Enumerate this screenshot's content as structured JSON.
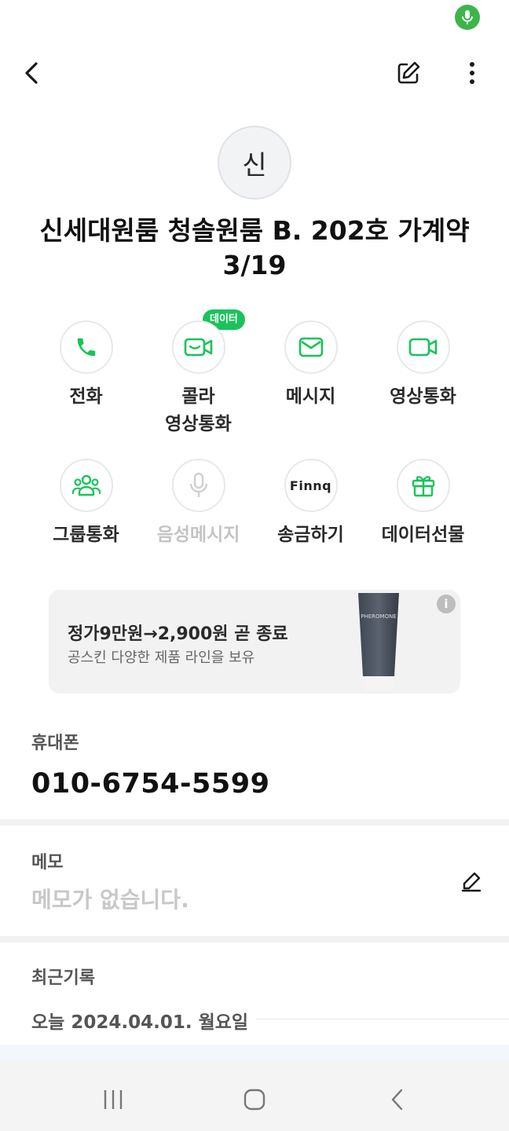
{
  "header": {
    "back_icon": "chevron-left-icon",
    "edit_icon": "edit-icon",
    "more_icon": "more-vertical-icon"
  },
  "contact": {
    "avatar_initial": "신",
    "name_line1": "신세대원룸 청솔원룸 B. 202호  가계약",
    "name_line2": "3/19"
  },
  "actions": [
    {
      "label": "전화",
      "icon": "phone-icon",
      "enabled": true
    },
    {
      "label": "콜라\n영상통화",
      "icon": "video-message-icon",
      "enabled": true,
      "badge": "데이터"
    },
    {
      "label": "메시지",
      "icon": "mail-icon",
      "enabled": true
    },
    {
      "label": "영상통화",
      "icon": "video-camera-icon",
      "enabled": true
    },
    {
      "label": "그룹통화",
      "icon": "group-icon",
      "enabled": true
    },
    {
      "label": "음성메시지",
      "icon": "microphone-icon",
      "enabled": false
    },
    {
      "label": "송금하기",
      "icon": "finnq-logo",
      "enabled": true,
      "icon_text": "Finnq"
    },
    {
      "label": "데이터선물",
      "icon": "gift-icon",
      "enabled": true
    }
  ],
  "action_labels": {
    "call": "전화",
    "cola_line1": "콜라",
    "cola_line2": "영상통화",
    "message": "메시지",
    "video": "영상통화",
    "group": "그룹통화",
    "voice_msg": "음성메시지",
    "transfer": "송금하기",
    "gift": "데이터선물",
    "badge": "데이터",
    "finnq": "Finnq"
  },
  "ad": {
    "headline": "정가9만원→2,900원 곧 종료",
    "sub": "공스킨 다양한 제품 라인을 보유",
    "product_label": "PHEROMONE",
    "info_label": "i"
  },
  "phone": {
    "label": "휴대폰",
    "number": "010-6754-5599"
  },
  "memo": {
    "label": "메모",
    "empty_text": "메모가 없습니다."
  },
  "recent": {
    "label": "최근기록",
    "date": "오늘 2024.04.01. 월요일"
  },
  "colors": {
    "accent_green": "#19c35a",
    "mic_indicator": "#3db54a"
  }
}
